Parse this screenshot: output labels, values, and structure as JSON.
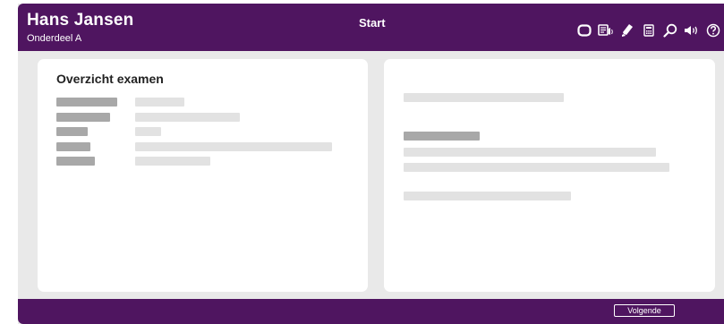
{
  "header": {
    "user_name": "Hans Jansen",
    "section": "Onderdeel A",
    "page_title": "Start",
    "tools": [
      {
        "icon": "flag-icon"
      },
      {
        "icon": "read-aloud-icon"
      },
      {
        "icon": "highlighter-icon"
      },
      {
        "icon": "calculator-icon"
      },
      {
        "icon": "magnifier-icon"
      },
      {
        "icon": "volume-icon"
      },
      {
        "icon": "help-icon"
      }
    ]
  },
  "left_panel": {
    "title": "Overzicht examen"
  },
  "footer": {
    "next_label": "Volgende"
  },
  "colors": {
    "brand": "#4f1560",
    "background": "#e9e9e9",
    "placeholder_dark": "#a8a8a8",
    "placeholder_light": "#e2e2e2"
  }
}
